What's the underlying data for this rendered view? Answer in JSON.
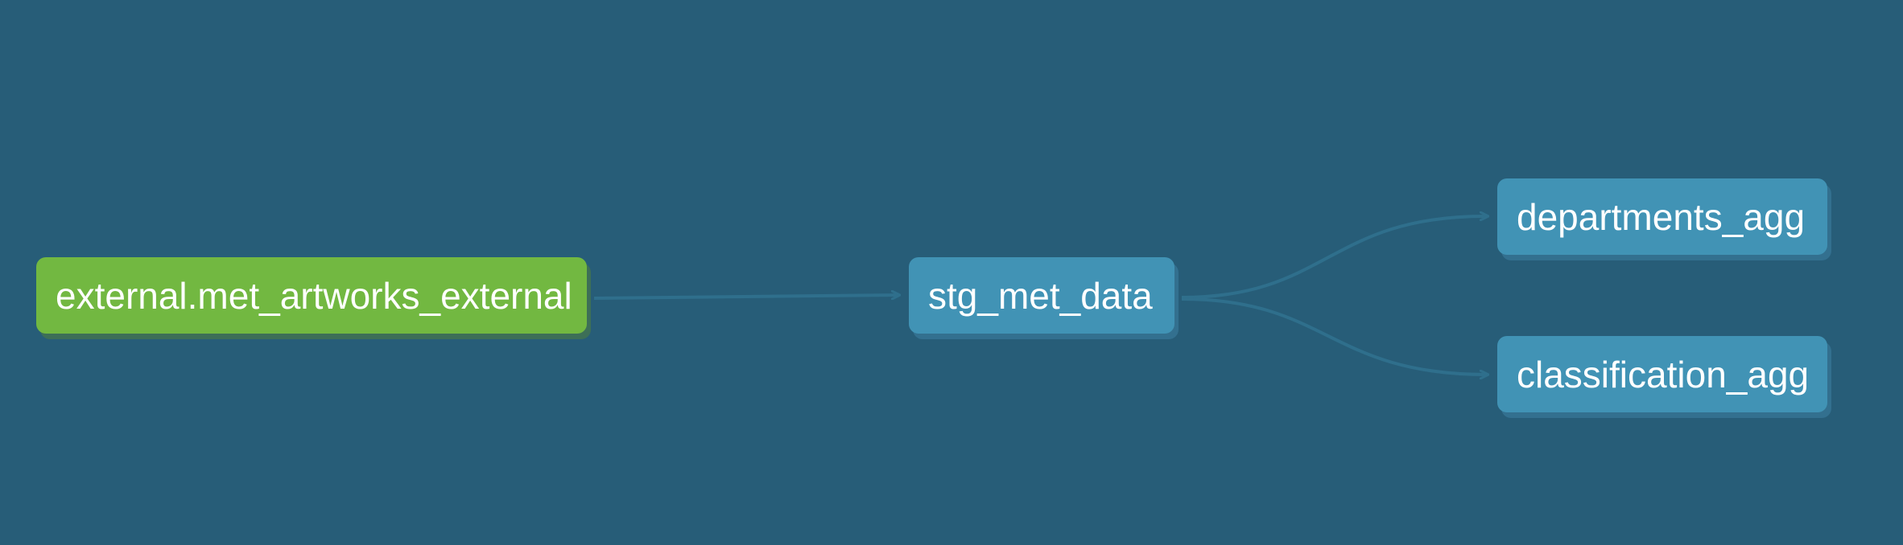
{
  "graph": {
    "nodes": [
      {
        "id": "source",
        "label": "external.met_artworks_external",
        "kind": "source"
      },
      {
        "id": "stg",
        "label": "stg_met_data",
        "kind": "model"
      },
      {
        "id": "dept",
        "label": "departments_agg",
        "kind": "model"
      },
      {
        "id": "class",
        "label": "classification_agg",
        "kind": "model"
      }
    ],
    "edges": [
      {
        "from": "source",
        "to": "stg"
      },
      {
        "from": "stg",
        "to": "dept"
      },
      {
        "from": "stg",
        "to": "class"
      }
    ]
  },
  "colors": {
    "background": "#275d78",
    "source_node": "#72b841",
    "model_node": "#4193b5",
    "edge": "#2f6f8c"
  }
}
